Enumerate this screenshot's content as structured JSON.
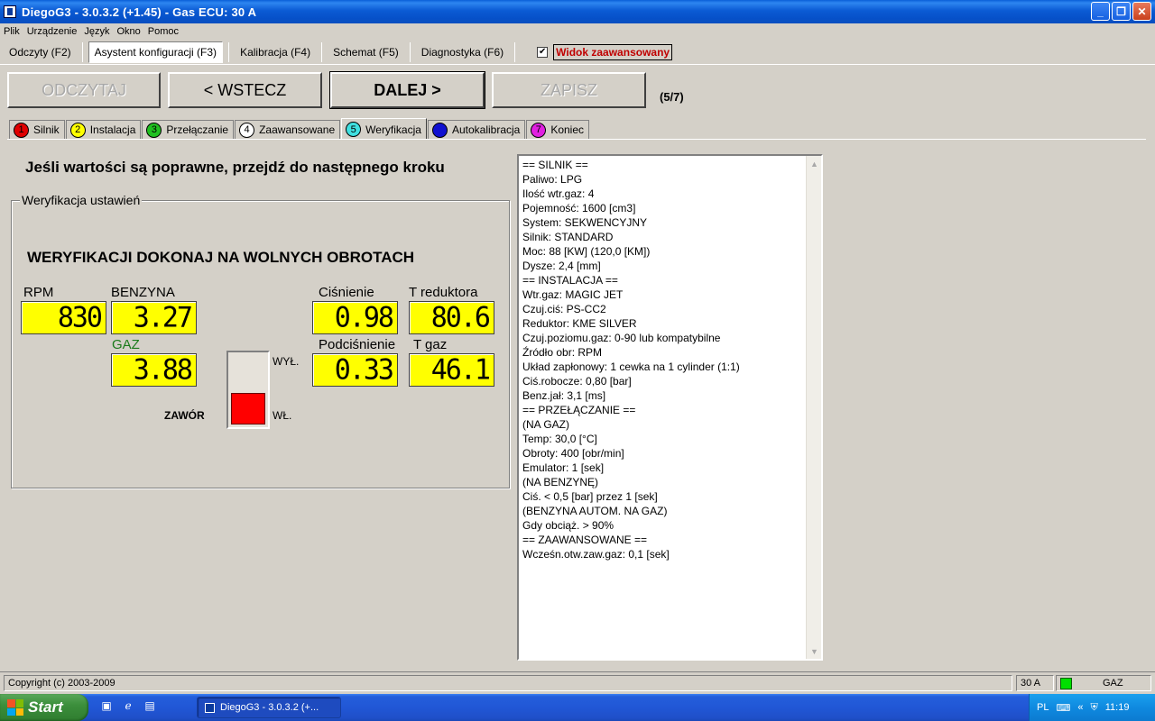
{
  "window": {
    "title": "DiegoG3 - 3.0.3.2 (+1.45) - Gas ECU: 30 A"
  },
  "menu": [
    "Plik",
    "Urządzenie",
    "Język",
    "Okno",
    "Pomoc"
  ],
  "modes": [
    {
      "label": "Odczyty (F2)"
    },
    {
      "label": "Asystent konfiguracji (F3)"
    },
    {
      "label": "Kalibracja (F4)"
    },
    {
      "label": "Schemat (F5)"
    },
    {
      "label": "Diagnostyka (F6)"
    }
  ],
  "advanced_view": {
    "label": "Widok zaawansowany",
    "checked": true
  },
  "nav": {
    "read": "ODCZYTAJ",
    "back": "< WSTECZ",
    "next": "DALEJ  >",
    "save": "ZAPISZ",
    "step": "(5/7)"
  },
  "tabs": [
    {
      "num": "1",
      "label": "Silnik",
      "color": "#e00000"
    },
    {
      "num": "2",
      "label": "Instalacja",
      "color": "#ffff00"
    },
    {
      "num": "3",
      "label": "Przełączanie",
      "color": "#20c020"
    },
    {
      "num": "4",
      "label": "Zaawansowane",
      "color": "#ffffff"
    },
    {
      "num": "5",
      "label": "Weryfikacja",
      "color": "#40e0e0"
    },
    {
      "num": "6",
      "label": "Autokalibracja",
      "color": "#1010d0"
    },
    {
      "num": "7",
      "label": "Koniec",
      "color": "#e020e0"
    }
  ],
  "headline": "Jeśli wartości są poprawne, przejdź do następnego kroku",
  "group": {
    "title": "Weryfikacja ustawień",
    "warning": "WERYFIKACJI DOKONAJ NA WOLNYCH OBROTACH"
  },
  "gauges": {
    "rpm": {
      "label": "RPM",
      "value": "830"
    },
    "benzyna": {
      "label": "BENZYNA",
      "value": "3.27"
    },
    "gaz": {
      "label": "GAZ",
      "value": "3.88"
    },
    "cisnienie": {
      "label": "Ciśnienie",
      "value": "0.98"
    },
    "t_reduktora": {
      "label": "T reduktora",
      "value": "80.6"
    },
    "podcisnienie": {
      "label": "Podciśnienie",
      "value": "0.33"
    },
    "t_gaz": {
      "label": "T gaz",
      "value": "46.1"
    }
  },
  "valve": {
    "label": "ZAWÓR",
    "off": "WYŁ.",
    "on": "WŁ.",
    "state_color": "#ff0000"
  },
  "summary": [
    "== SILNIK ==",
    "Paliwo: LPG",
    "Ilość wtr.gaz: 4",
    "Pojemność: 1600 [cm3]",
    "System: SEKWENCYJNY",
    "Silnik: STANDARD",
    "Moc: 88 [KW] (120,0 [KM])",
    "Dysze: 2,4 [mm]",
    "== INSTALACJA ==",
    "Wtr.gaz: MAGIC JET",
    "Czuj.ciś: PS-CC2",
    "Reduktor: KME SILVER",
    "Czuj.poziomu.gaz: 0-90 lub kompatybilne",
    "Źródło obr: RPM",
    "Układ zapłonowy: 1 cewka na 1 cylinder (1:1)",
    "Ciś.robocze: 0,80 [bar]",
    "Benz.jał: 3,1 [ms]",
    "== PRZEŁĄCZANIE ==",
    "(NA GAZ)",
    "Temp: 30,0 [°C]",
    "Obroty: 400 [obr/min]",
    "Emulator: 1 [sek]",
    "(NA BENZYNĘ)",
    "Ciś. < 0,5 [bar] przez 1 [sek]",
    "(BENZYNA AUTOM. NA GAZ)",
    "Gdy obciąż. > 90%",
    "== ZAAWANSOWANE ==",
    "Wcześn.otw.zaw.gaz: 0,1 [sek]"
  ],
  "status": {
    "copyright": "Copyright (c) 2003-2009",
    "ecu": "30 A",
    "fuel": "GAZ",
    "led_color": "#00e000"
  },
  "taskbar": {
    "start": "Start",
    "task": "DiegoG3 - 3.0.3.2 (+...",
    "lang": "PL",
    "clock": "11:19"
  }
}
